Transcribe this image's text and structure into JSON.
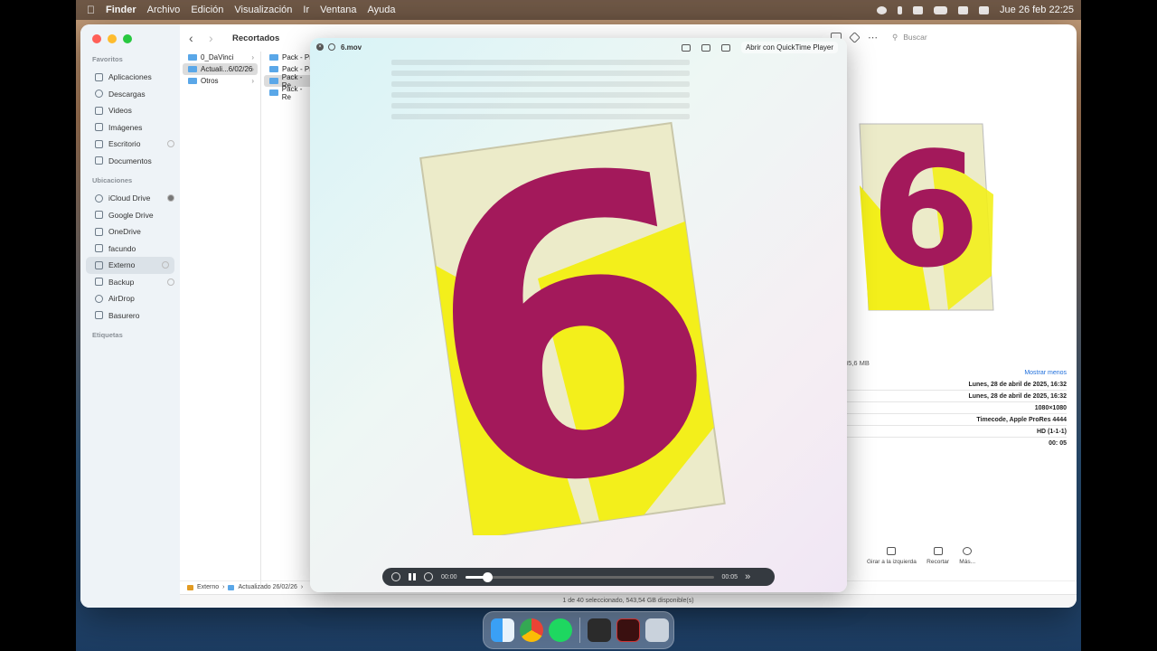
{
  "menubar": {
    "app_name": "Finder",
    "items": [
      "Archivo",
      "Edición",
      "Visualización",
      "Ir",
      "Ventana",
      "Ayuda"
    ],
    "clock": "Jue 26 feb  22:25"
  },
  "finder": {
    "title": "Recortados",
    "search_placeholder": "Buscar",
    "sidebar": {
      "favorites_header": "Favoritos",
      "favorites": [
        "Aplicaciones",
        "Descargas",
        "Videos",
        "Imágenes",
        "Escritorio",
        "Documentos"
      ],
      "locations_header": "Ubicaciones",
      "locations": [
        "iCloud Drive",
        "Google Drive",
        "OneDrive",
        "facundo",
        "Externo",
        "Backup",
        "AirDrop",
        "Basurero"
      ],
      "tags_header": "Etiquetas"
    },
    "column1": [
      "0_DaVinci",
      "Actuali...6/02/26",
      "Otros"
    ],
    "column2": [
      "Pack - Pr",
      "Pack - Pr",
      "Pack - Re",
      "Pack - Re"
    ],
    "info": {
      "size": "85,6 MB",
      "more_link": "Mostrar menos",
      "rows": [
        "Lunes, 28 de abril de 2025, 16:32",
        "Lunes, 28 de abril de 2025, 16:32",
        "1080×1080",
        "Timecode, Apple ProRes 4444",
        "HD (1-1-1)",
        "00: 05"
      ]
    },
    "actions": [
      "Girar a la izquierda",
      "Recortar",
      "Más..."
    ],
    "pathbar": [
      "Externo",
      "Actualizado 26/02/26"
    ],
    "status": "1 de 40 seleccionado, 543,54 GB disponible(s)"
  },
  "quicklook": {
    "filename": "6.mov",
    "open_button": "Abrir con QuickTime Player",
    "digit": "6",
    "time_current": "00:00",
    "time_end": "00:05",
    "progress": 0.09
  },
  "colors": {
    "digit_magenta": "#a3195b",
    "paper": "#ecebc9",
    "yellow": "#f3ef1b"
  }
}
